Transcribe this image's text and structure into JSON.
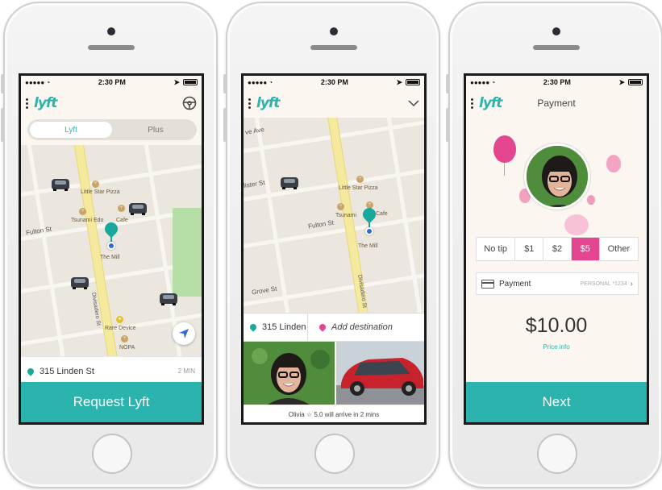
{
  "status": {
    "time": "2:30 PM"
  },
  "brand": {
    "logo": "lyft"
  },
  "phone1": {
    "tabs": [
      {
        "label": "Lyft"
      },
      {
        "label": "Plus"
      }
    ],
    "map": {
      "streets": {
        "fulton": "Fulton St",
        "divisadero": "Divisadero St"
      },
      "pois": {
        "little_star": "Little Star Pizza",
        "tsunami": "Tsunami",
        "edo": "Edo",
        "cafe": "Cafe",
        "the_mill": "The Mill",
        "rare_device": "Rare Device",
        "nopa": "NOPA"
      }
    },
    "pickup": {
      "address": "315 Linden St",
      "eta": "2 MIN"
    },
    "request_label": "Request Lyft"
  },
  "phone2": {
    "map": {
      "streets": {
        "ave": "ve Ave",
        "mister": "lister St",
        "fulton": "Fulton St",
        "grove": "Grove St",
        "divisadero": "Divisadero St"
      },
      "pois": {
        "little_star": "Little Star Pizza",
        "tsunami": "Tsunami",
        "cafe": "Cafe",
        "the_mill": "The Mill"
      }
    },
    "pickup": {
      "address": "315 Linden"
    },
    "destination_placeholder": "Add destination",
    "driver_caption": "Olivia ☆ 5.0 will arrive in 2 mins"
  },
  "phone3": {
    "title": "Payment",
    "tips": [
      {
        "label": "No tip"
      },
      {
        "label": "$1"
      },
      {
        "label": "$2"
      },
      {
        "label": "$5"
      },
      {
        "label": "Other"
      }
    ],
    "selected_tip": "$5",
    "payment": {
      "label": "Payment",
      "method": "PERSONAL *1234"
    },
    "amount": "$10.00",
    "price_info": "Price info",
    "next_label": "Next"
  },
  "colors": {
    "teal": "#2bb3ad",
    "pink": "#e4458f",
    "map_bg": "#ebe7df",
    "avenue": "#f4e99c",
    "park": "#b5dfa6"
  }
}
